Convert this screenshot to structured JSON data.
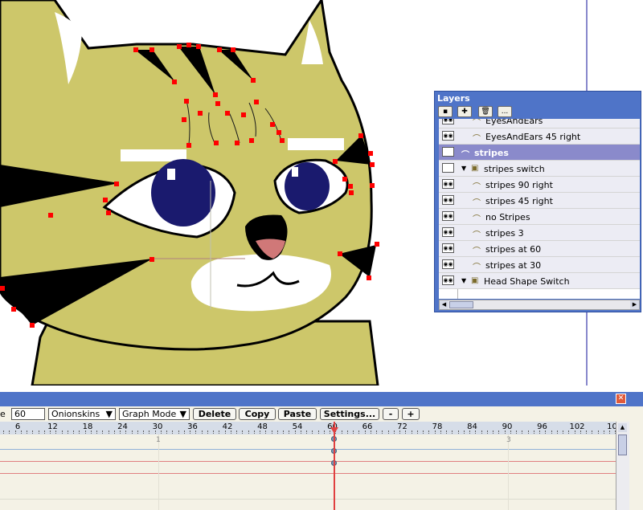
{
  "layers_panel": {
    "title": "Layers",
    "toolbar": [
      {
        "icon": "new-layer-icon"
      },
      {
        "icon": "add-layer-icon"
      },
      {
        "icon": "trash-icon"
      },
      {
        "icon": "more-icon",
        "label": "..."
      }
    ],
    "rows": [
      {
        "label": "EyesAndEars",
        "type": "bone",
        "visible": true,
        "selected": false,
        "indent": 1
      },
      {
        "label": "EyesAndEars 45 right",
        "type": "bone",
        "visible": true,
        "selected": false,
        "indent": 1
      },
      {
        "label": "stripes",
        "type": "bone",
        "visible": true,
        "selected": true,
        "indent": 0
      },
      {
        "label": "stripes switch",
        "type": "switch",
        "visible": false,
        "selected": false,
        "indent": 0,
        "expanded": true
      },
      {
        "label": "stripes 90 right",
        "type": "bone",
        "visible": true,
        "selected": false,
        "indent": 1
      },
      {
        "label": "stripes 45 right",
        "type": "bone",
        "visible": true,
        "selected": false,
        "indent": 1
      },
      {
        "label": "no Stripes",
        "type": "bone",
        "visible": true,
        "selected": false,
        "indent": 1
      },
      {
        "label": "stripes 3",
        "type": "bone",
        "visible": true,
        "selected": false,
        "indent": 1
      },
      {
        "label": "stripes at 60",
        "type": "bone",
        "visible": true,
        "selected": false,
        "indent": 1
      },
      {
        "label": "stripes at 30",
        "type": "bone",
        "visible": true,
        "selected": false,
        "indent": 1
      },
      {
        "label": "Head Shape Switch",
        "type": "switch",
        "visible": true,
        "selected": false,
        "indent": 0,
        "expanded": true
      }
    ]
  },
  "timeline": {
    "frame_label": "e",
    "frame_value": "60",
    "onionskins_label": "Onionskins",
    "graph_mode_label": "Graph Mode",
    "delete_label": "Delete",
    "copy_label": "Copy",
    "paste_label": "Paste",
    "settings_label": "Settings...",
    "minus_label": "-",
    "plus_label": "+",
    "ruler_ticks": [
      "6",
      "12",
      "18",
      "24",
      "30",
      "36",
      "42",
      "48",
      "54",
      "60",
      "66",
      "72",
      "78",
      "84",
      "90",
      "96",
      "102",
      "10"
    ],
    "row_numbers": [
      "1",
      "3"
    ],
    "current_frame": 60
  },
  "colors": {
    "window_title_blue": "#4f74c8",
    "selected_layer": "#8a8acb",
    "cat_fur": "#cdc76a",
    "cat_stripe": "#000000",
    "eye_iris": "#1a1a6e",
    "nose_pink": "#d07878",
    "control_point": "#ff0000",
    "playhead": "#e04040"
  }
}
